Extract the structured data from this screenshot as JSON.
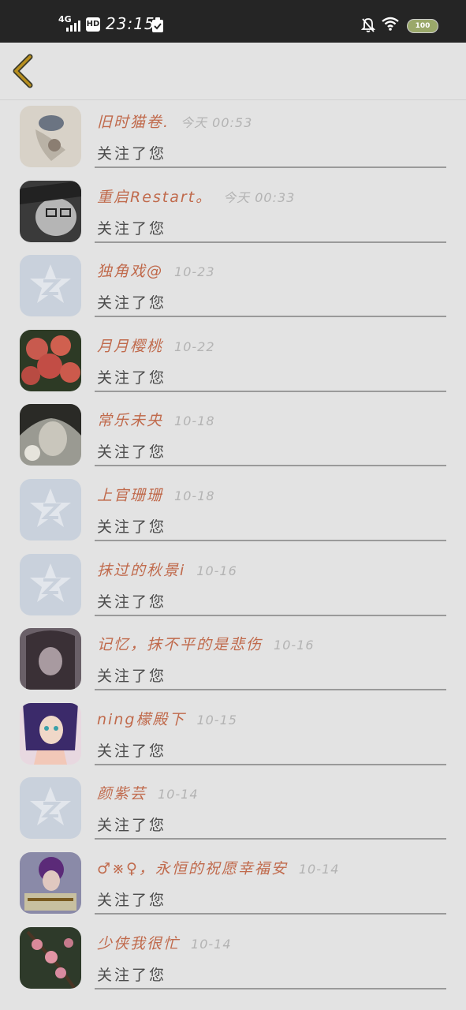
{
  "status_bar": {
    "network": "4G",
    "hd": "HD",
    "time": "23:15",
    "battery": "100"
  },
  "header": {
    "back_icon": "chevron-left-icon"
  },
  "followers": [
    {
      "name": "旧时猫卷.",
      "time": "今天 00:53",
      "action": "关注了您",
      "avatar": "photo-sketch"
    },
    {
      "name": "重启Restart。",
      "time": "今天 00:33",
      "action": "关注了您",
      "avatar": "photo-portrait-glasses"
    },
    {
      "name": "独角戏@",
      "time": "10-23",
      "action": "关注了您",
      "avatar": "default-star"
    },
    {
      "name": "月月樱桃",
      "time": "10-22",
      "action": "关注了您",
      "avatar": "photo-flowers"
    },
    {
      "name": "常乐未央",
      "time": "10-18",
      "action": "关注了您",
      "avatar": "photo-girl-bw"
    },
    {
      "name": "上官珊珊",
      "time": "10-18",
      "action": "关注了您",
      "avatar": "default-star"
    },
    {
      "name": "抹过的秋景i",
      "time": "10-16",
      "action": "关注了您",
      "avatar": "default-star"
    },
    {
      "name": "记忆，抹不平的是悲伤",
      "time": "10-16",
      "action": "关注了您",
      "avatar": "photo-girl-dark"
    },
    {
      "name": "ning檬殿下",
      "time": "10-15",
      "action": "关注了您",
      "avatar": "photo-anime"
    },
    {
      "name": "颜紫芸",
      "time": "10-14",
      "action": "关注了您",
      "avatar": "default-star"
    },
    {
      "name": "♂※♀，永恒的祝愿幸福安",
      "time": "10-14",
      "action": "关注了您",
      "avatar": "photo-girl-purple"
    },
    {
      "name": "少侠我很忙",
      "time": "10-14",
      "action": "关注了您",
      "avatar": "photo-blossom"
    }
  ],
  "colors": {
    "name": "#c06a4c",
    "accent_back": "#b88f1e",
    "background": "#e3e3e3"
  }
}
